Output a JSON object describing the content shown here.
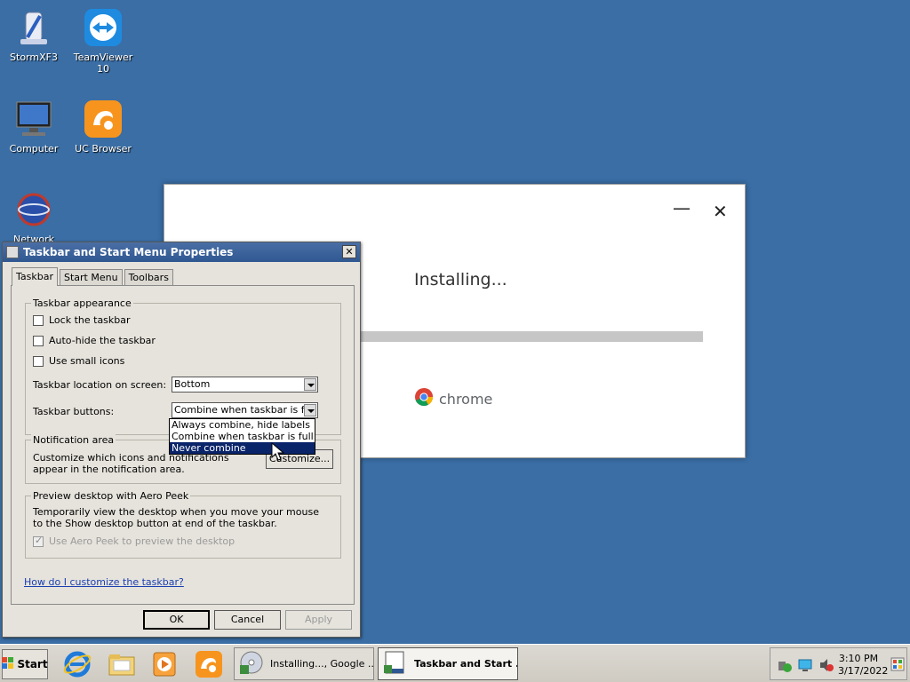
{
  "desktop": {
    "icons": [
      {
        "label": "StormXF3"
      },
      {
        "label": "TeamViewer 10"
      },
      {
        "label": "Computer"
      },
      {
        "label": "UC Browser"
      },
      {
        "label": "Network"
      }
    ]
  },
  "installer": {
    "minimize": "—",
    "close": "✕",
    "status": "Installing...",
    "brand": "chrome",
    "progress": 0
  },
  "dialog": {
    "title": "Taskbar and Start Menu Properties",
    "close": "✕",
    "tabs": [
      "Taskbar",
      "Start Menu",
      "Toolbars"
    ],
    "appearance": {
      "legend": "Taskbar appearance",
      "lock": "Lock the taskbar",
      "autohide": "Auto-hide the taskbar",
      "small_icons": "Use small icons",
      "location_label": "Taskbar location on screen:",
      "location_value": "Bottom",
      "buttons_label": "Taskbar buttons:",
      "buttons_value": "Combine when taskbar is full",
      "options": [
        "Always combine, hide labels",
        "Combine when taskbar is full",
        "Never combine"
      ]
    },
    "notification": {
      "legend": "Notification area",
      "text": "Customize which icons and notifications appear in the notification area.",
      "customize": "Customize..."
    },
    "aero": {
      "legend": "Preview desktop with Aero Peek",
      "text": "Temporarily view the desktop when you move your mouse to the Show desktop button at end of the taskbar.",
      "checkbox": "Use Aero Peek to preview the desktop"
    },
    "help_link": "How do I customize the taskbar?",
    "ok": "OK",
    "cancel": "Cancel",
    "apply": "Apply"
  },
  "taskbar": {
    "start": "Start",
    "buttons": [
      "Installing..., Google ...",
      "Taskbar and Start ..."
    ],
    "clock_time": "3:10 PM",
    "clock_date": "3/17/2022"
  }
}
